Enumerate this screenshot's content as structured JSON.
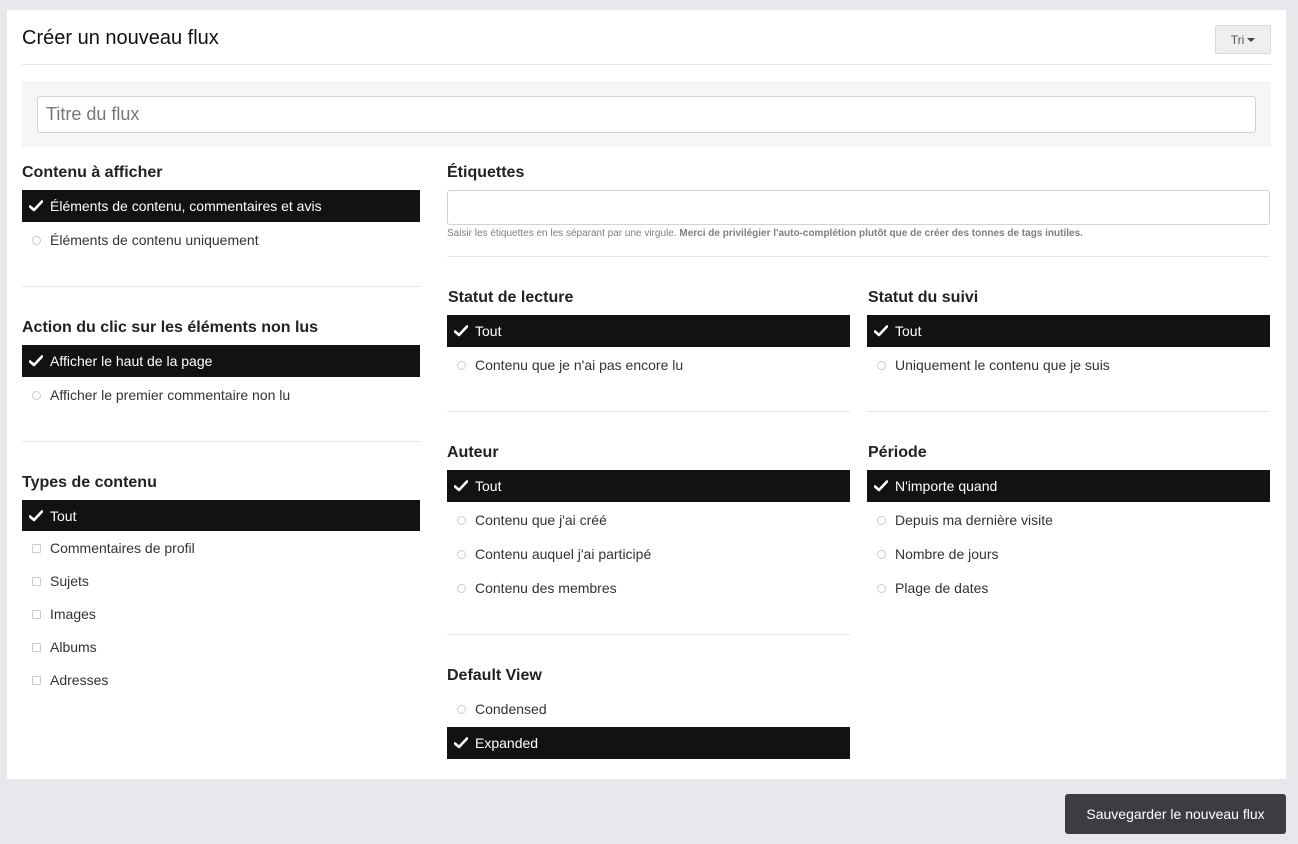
{
  "header": {
    "title": "Créer un nouveau flux",
    "sort_label": "Tri"
  },
  "title_field": {
    "placeholder": "Titre du flux",
    "value": ""
  },
  "content_display": {
    "title": "Contenu à afficher",
    "options": [
      {
        "label": "Éléments de contenu, commentaires et avis",
        "selected": true
      },
      {
        "label": "Éléments de contenu uniquement",
        "selected": false
      }
    ]
  },
  "click_action": {
    "title": "Action du clic sur les éléments non lus",
    "options": [
      {
        "label": "Afficher le haut de la page",
        "selected": true
      },
      {
        "label": "Afficher le premier commentaire non lu",
        "selected": false
      }
    ]
  },
  "content_types": {
    "title": "Types de contenu",
    "options": [
      {
        "label": "Tout",
        "selected": true
      },
      {
        "label": "Commentaires de profil",
        "selected": false
      },
      {
        "label": "Sujets",
        "selected": false
      },
      {
        "label": "Images",
        "selected": false
      },
      {
        "label": "Albums",
        "selected": false
      },
      {
        "label": "Adresses",
        "selected": false
      }
    ]
  },
  "tags": {
    "title": "Étiquettes",
    "value": "",
    "hint": "Saisir les étiquettes en les séparant par une virgule.",
    "hint_bold": "Merci de privilégier l'auto-complétion plutôt que de créer des tonnes de tags inutiles."
  },
  "read_status": {
    "title": "Statut de lecture",
    "options": [
      {
        "label": "Tout",
        "selected": true
      },
      {
        "label": "Contenu que je n'ai pas encore lu",
        "selected": false
      }
    ]
  },
  "follow_status": {
    "title": "Statut du suivi",
    "options": [
      {
        "label": "Tout",
        "selected": true
      },
      {
        "label": "Uniquement le contenu que je suis",
        "selected": false
      }
    ]
  },
  "author": {
    "title": "Auteur",
    "options": [
      {
        "label": "Tout",
        "selected": true
      },
      {
        "label": "Contenu que j'ai créé",
        "selected": false
      },
      {
        "label": "Contenu auquel j'ai participé",
        "selected": false
      },
      {
        "label": "Contenu des membres",
        "selected": false
      }
    ]
  },
  "period": {
    "title": "Période",
    "options": [
      {
        "label": "N'importe quand",
        "selected": true
      },
      {
        "label": "Depuis ma dernière visite",
        "selected": false
      },
      {
        "label": "Nombre de jours",
        "selected": false
      },
      {
        "label": "Plage de dates",
        "selected": false
      }
    ]
  },
  "default_view": {
    "title": "Default View",
    "options": [
      {
        "label": "Condensed",
        "selected": false
      },
      {
        "label": "Expanded",
        "selected": true
      }
    ]
  },
  "footer": {
    "save_label": "Sauvegarder le nouveau flux"
  },
  "colors": {
    "selected_bg": "#121212",
    "save_bg": "#3c3d43",
    "page_bg": "#e7e8ec"
  }
}
